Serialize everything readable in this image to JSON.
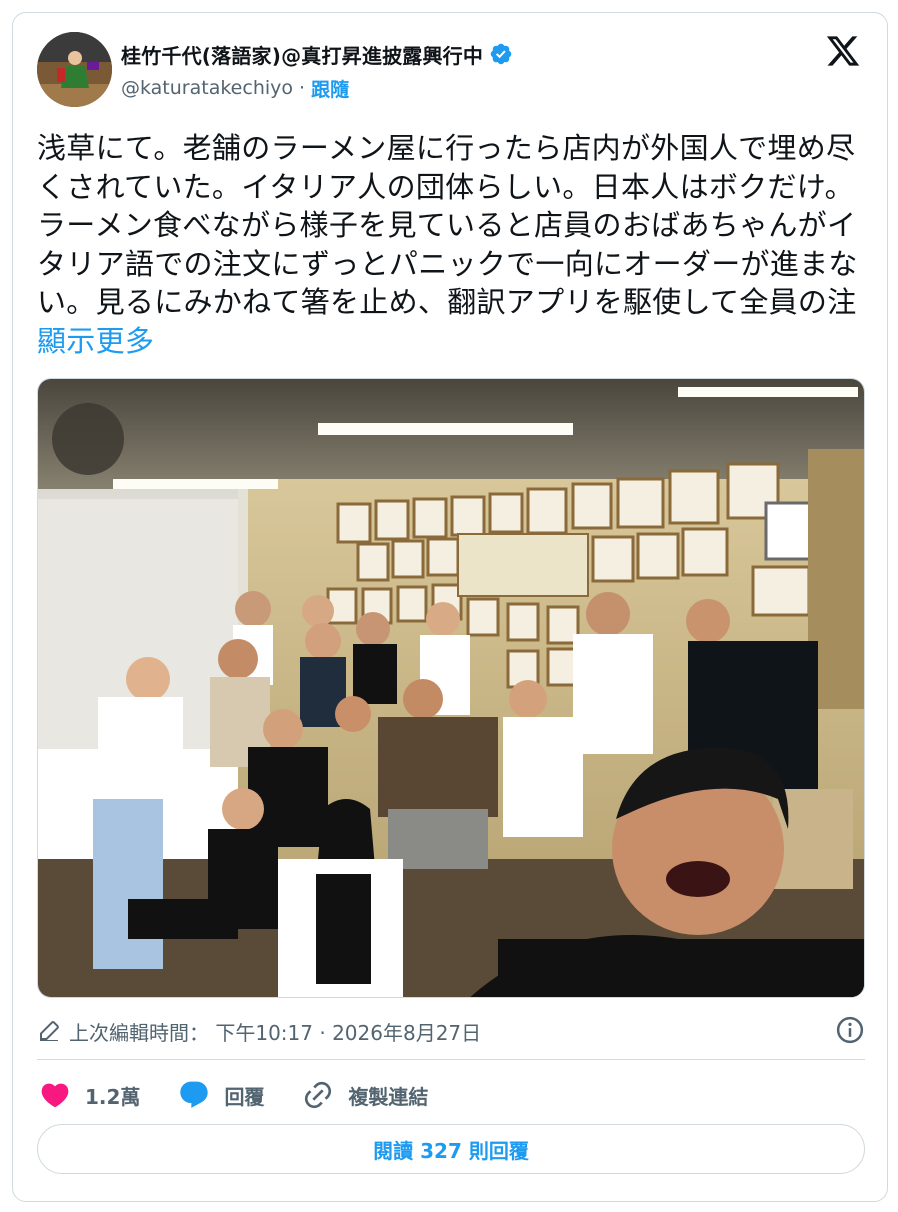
{
  "author": {
    "display_name": "桂竹千代(落語家)@真打昇進披露興行中",
    "handle": "@katuratakechiyo",
    "separator": "·",
    "follow_label": "跟隨"
  },
  "tweet": {
    "text": "浅草にて。老舗のラーメン屋に行ったら店内が外国人で埋め尽くされていた。イタリア人の団体らしい。日本人はボクだけ。ラーメン食べながら様子を見ていると店員のおばあちゃんがイタリア語での注文にずっとパニックで一向にオーダーが進まない。見るにみかねて箸を止め、翻訳アプリを駆使して全員の注",
    "show_more": "顯示更多"
  },
  "meta": {
    "edited_text": "上次編輯時間： 下午10:17 · 2026年8月27日"
  },
  "actions": {
    "like_count": "1.2萬",
    "reply_label": "回覆",
    "copy_link_label": "複製連結"
  },
  "read_replies_label": "閱讀 327 則回覆",
  "colors": {
    "accent": "#1d9bf0",
    "like": "#f91880",
    "muted": "#536471",
    "border": "#cfd9de"
  },
  "icons": [
    "verified-badge-icon",
    "x-logo-icon",
    "pencil-icon",
    "info-icon",
    "heart-icon",
    "reply-bubble-icon",
    "link-icon"
  ]
}
